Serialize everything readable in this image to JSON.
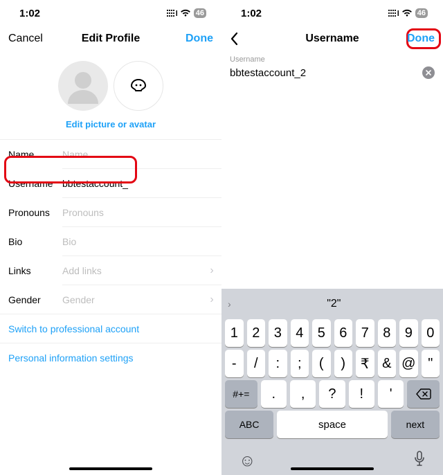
{
  "status": {
    "time": "1:02",
    "battery": "46"
  },
  "left": {
    "nav": {
      "cancel": "Cancel",
      "title": "Edit Profile",
      "done": "Done"
    },
    "editPicture": "Edit picture or avatar",
    "rows": {
      "name": {
        "label": "Name",
        "placeholder": "Name"
      },
      "username": {
        "label": "Username",
        "value": "bbtestaccount_"
      },
      "pronouns": {
        "label": "Pronouns",
        "placeholder": "Pronouns"
      },
      "bio": {
        "label": "Bio",
        "placeholder": "Bio"
      },
      "links": {
        "label": "Links",
        "placeholder": "Add links"
      },
      "gender": {
        "label": "Gender",
        "placeholder": "Gender"
      }
    },
    "links": {
      "switch": "Switch to professional account",
      "personal": "Personal information settings"
    }
  },
  "right": {
    "nav": {
      "title": "Username",
      "done": "Done"
    },
    "field": {
      "label": "Username",
      "value": "bbtestaccount_2"
    },
    "kbd": {
      "suggestion": "\"2\"",
      "row1": [
        "1",
        "2",
        "3",
        "4",
        "5",
        "6",
        "7",
        "8",
        "9",
        "0"
      ],
      "row2": [
        "-",
        "/",
        ":",
        ";",
        "(",
        ")",
        "₹",
        "&",
        "@",
        "\""
      ],
      "row3": {
        "shift": "#+=",
        "keys": [
          ".",
          ",",
          "?",
          "!",
          "'"
        ],
        "del": "⌫"
      },
      "row4": {
        "abc": "ABC",
        "space": "space",
        "next": "next"
      }
    }
  }
}
